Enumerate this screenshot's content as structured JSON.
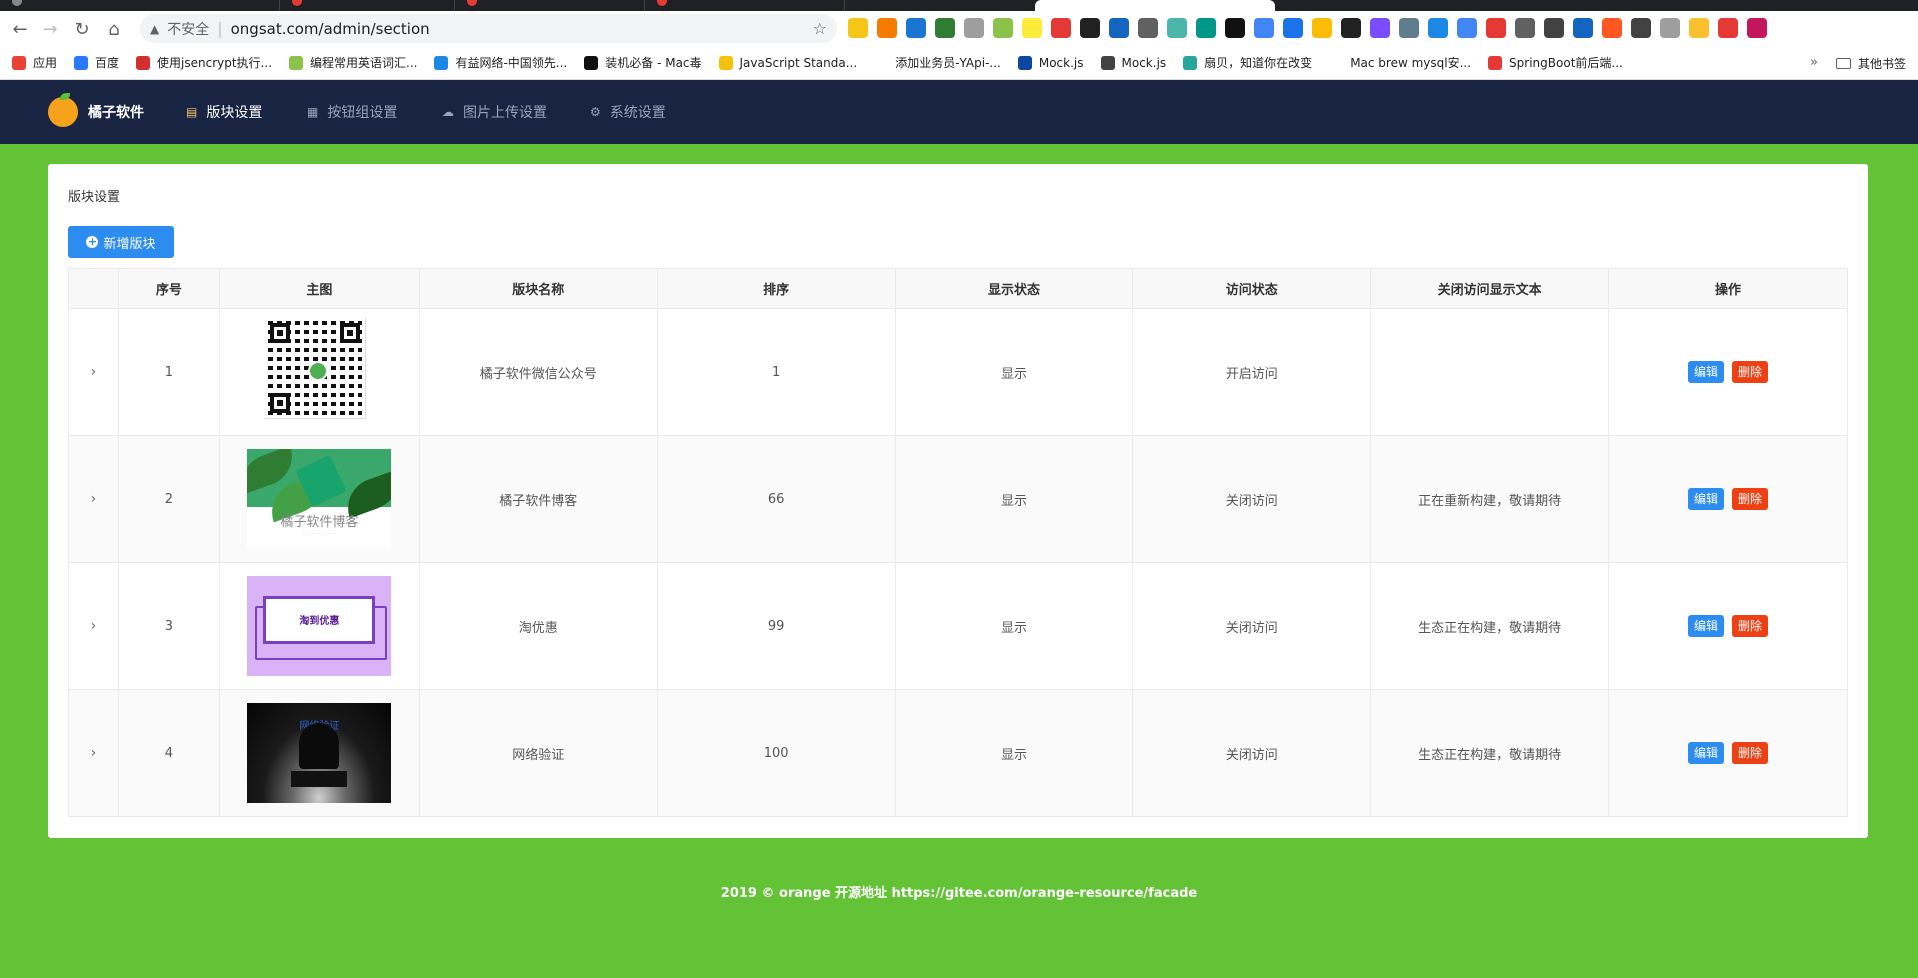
{
  "browser": {
    "insecure_label": "不安全",
    "url": "ongsat.com/admin/section",
    "bookmarks": [
      {
        "label": "应用",
        "color": "#ea4335"
      },
      {
        "label": "百度",
        "color": "#2979ff"
      },
      {
        "label": "使用jsencrypt执行...",
        "color": "#d32f2f"
      },
      {
        "label": "编程常用英语词汇...",
        "color": "#8bc34a"
      },
      {
        "label": "有益网络-中国领先...",
        "color": "#1e88e5"
      },
      {
        "label": "装机必备 - Mac毒",
        "color": "#111111"
      },
      {
        "label": "JavaScript Standa...",
        "color": "#f4c20d"
      },
      {
        "label": "添加业务员-YApi-...",
        "color": "#ffffff"
      },
      {
        "label": "Mock.js",
        "color": "#0d47a1"
      },
      {
        "label": "Mock.js",
        "color": "#424242"
      },
      {
        "label": "扇贝，知道你在改变",
        "color": "#26a69a"
      },
      {
        "label": "Mac brew mysql安...",
        "color": "#ffffff"
      },
      {
        "label": "SpringBoot前后端...",
        "color": "#e53935"
      }
    ],
    "more_label": "»",
    "other_bookmarks": "其他书签",
    "extension_colors": [
      "#f5c518",
      "#f57c00",
      "#1976d2",
      "#2e7d32",
      "#9e9e9e",
      "#8bc34a",
      "#ffeb3b",
      "#e53935",
      "#212121",
      "#1565c0",
      "#616161",
      "#4db6ac",
      "#009688",
      "#111111",
      "#4285f4",
      "#1a73e8",
      "#fbbc04",
      "#212121",
      "#7c4dff",
      "#607d8b",
      "#1e88e5",
      "#4285f4",
      "#e53935",
      "#616161",
      "#424242",
      "#1565c0",
      "#ff5722",
      "#424242",
      "#9e9e9e",
      "#fbc02d",
      "#e53935",
      "#c2185b"
    ]
  },
  "app": {
    "logo_text": "橘子软件",
    "nav": [
      {
        "label": "版块设置",
        "icon": "list-icon",
        "glyph": "▤",
        "active": true
      },
      {
        "label": "按钮组设置",
        "icon": "grid-icon",
        "glyph": "▦",
        "active": false
      },
      {
        "label": "图片上传设置",
        "icon": "cloud-upload-icon",
        "glyph": "☁",
        "active": false
      },
      {
        "label": "系统设置",
        "icon": "gear-icon",
        "glyph": "⚙",
        "active": false
      }
    ]
  },
  "page": {
    "title": "版块设置",
    "add_button": "新增版块",
    "table": {
      "headers": [
        "",
        "序号",
        "主图",
        "版块名称",
        "排序",
        "显示状态",
        "访问状态",
        "关闭访问显示文本",
        "操作"
      ],
      "rows": [
        {
          "index": "1",
          "image": "qr-code",
          "name": "橘子软件微信公众号",
          "sort": "1",
          "display": "显示",
          "access": "开启访问",
          "closed_text": ""
        },
        {
          "index": "2",
          "image": "blog-banner",
          "image_caption": "橘子软件博客",
          "name": "橘子软件博客",
          "sort": "66",
          "display": "显示",
          "access": "关闭访问",
          "closed_text": "正在重新构建，敬请期待"
        },
        {
          "index": "3",
          "image": "taoyouhui-banner",
          "image_caption": "淘到优惠",
          "name": "淘优惠",
          "sort": "99",
          "display": "显示",
          "access": "关闭访问",
          "closed_text": "生态正在构建，敬请期待"
        },
        {
          "index": "4",
          "image": "network-banner",
          "image_caption": "网络验证",
          "name": "网络验证",
          "sort": "100",
          "display": "显示",
          "access": "关闭访问",
          "closed_text": "生态正在构建，敬请期待"
        }
      ],
      "edit_label": "编辑",
      "delete_label": "删除",
      "expand_glyph": "›"
    }
  },
  "footer": "2019 © orange 开源地址 https://gitee.com/orange-resource/facade",
  "colors": {
    "header_bg": "#192342",
    "content_bg": "#63c235",
    "primary": "#2d8cf0",
    "danger": "#ed4014"
  }
}
